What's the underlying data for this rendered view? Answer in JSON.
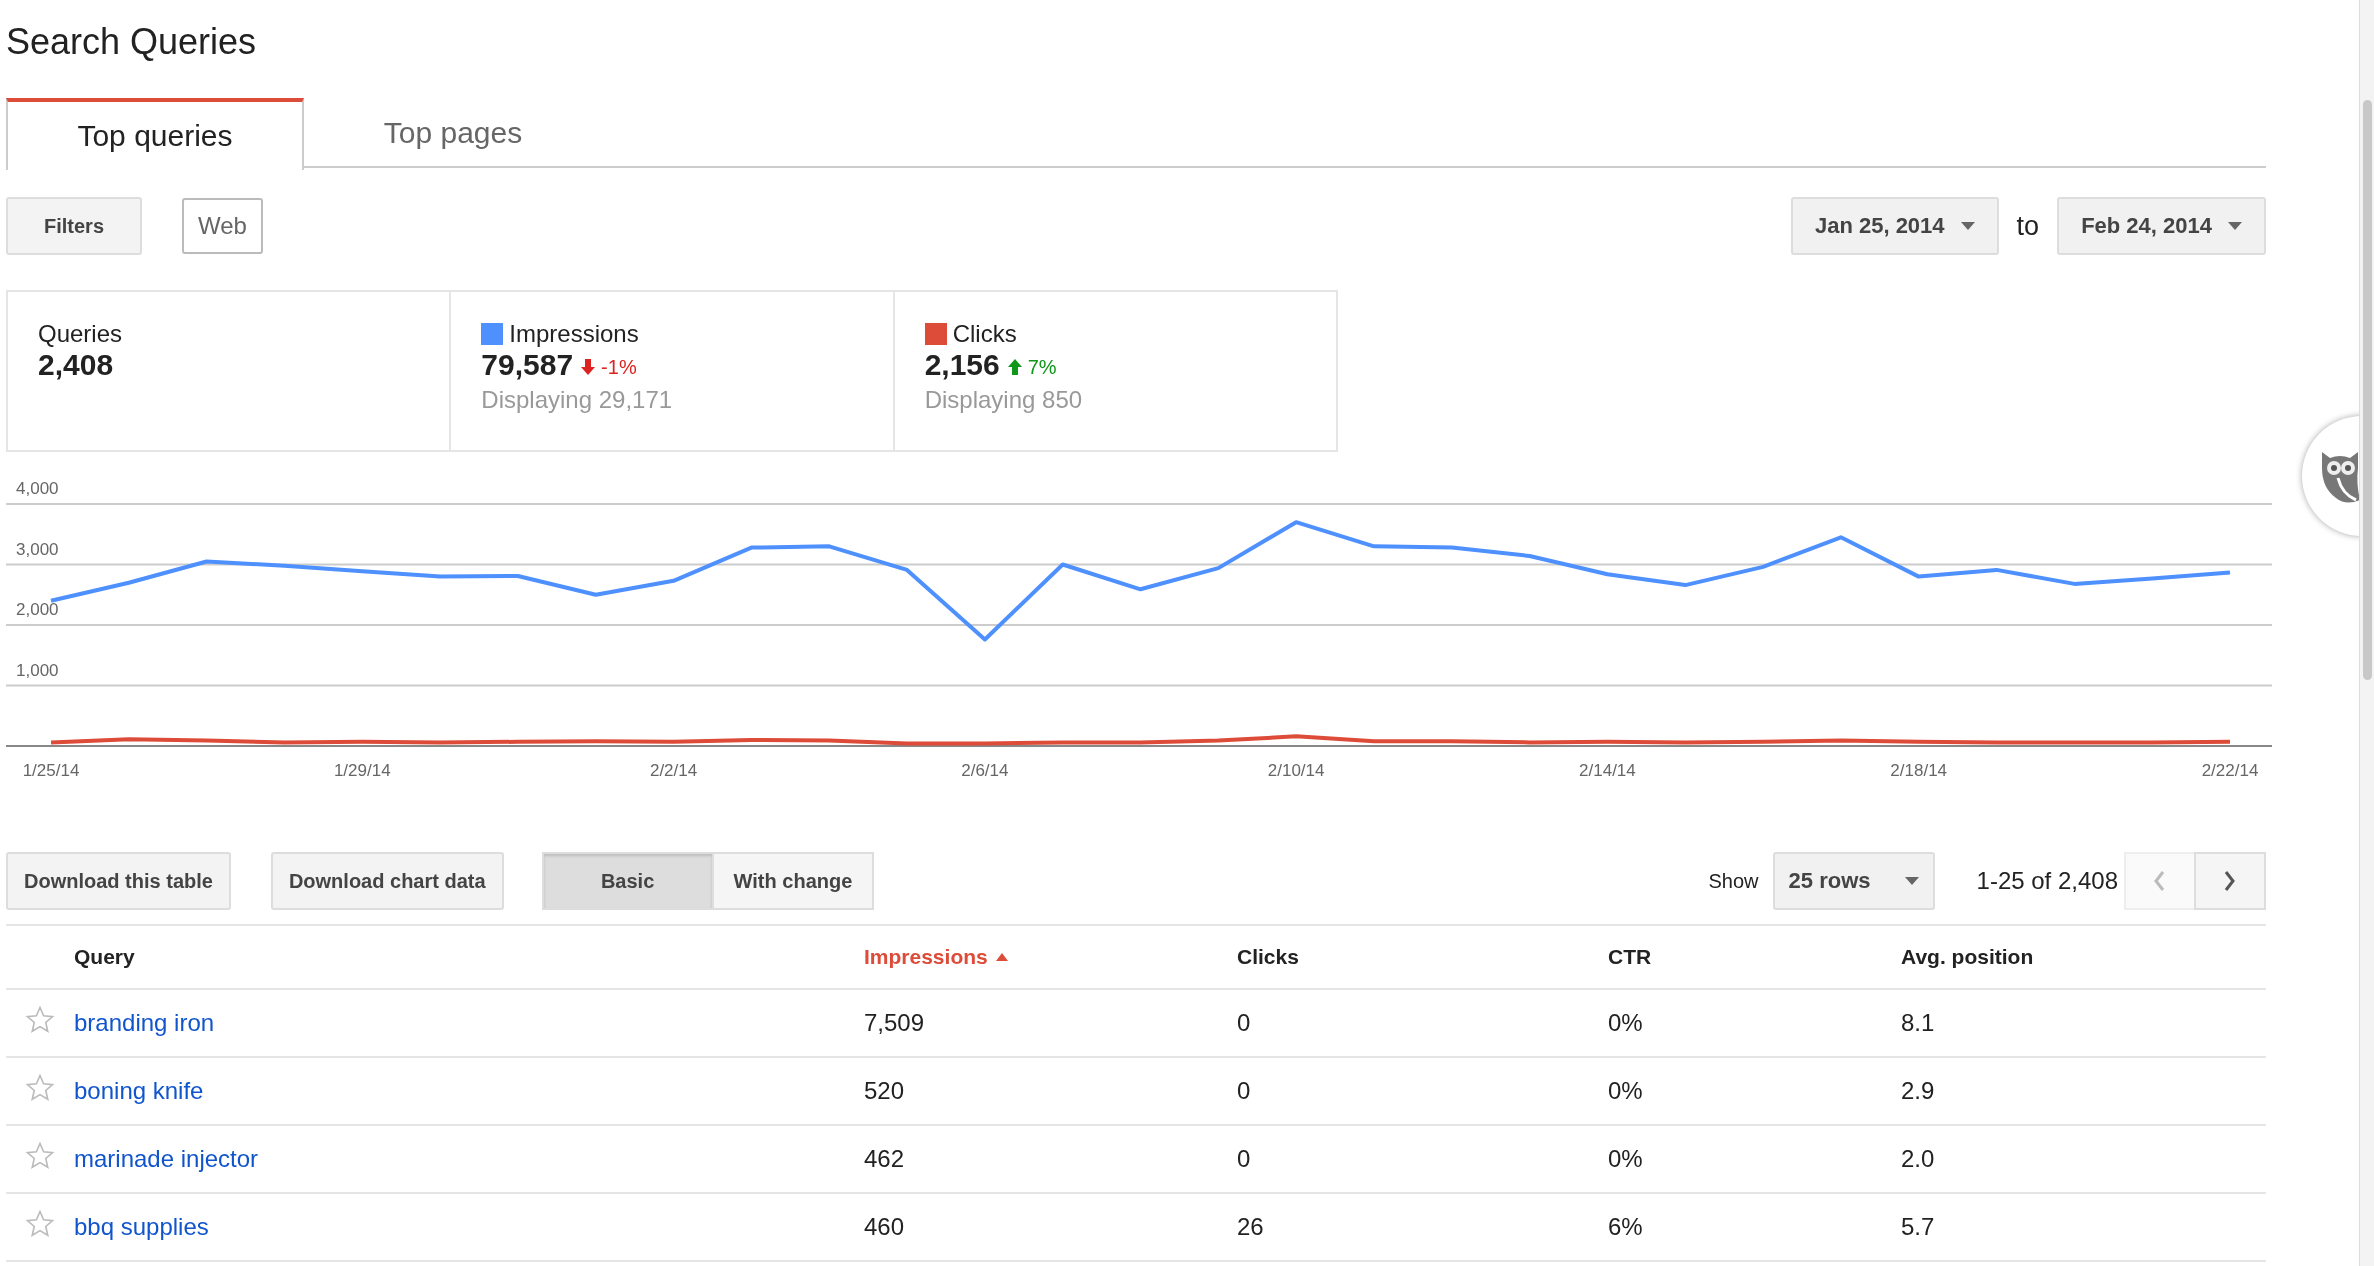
{
  "page": {
    "title": "Search Queries"
  },
  "tabs": [
    {
      "label": "Top queries",
      "selected": true
    },
    {
      "label": "Top pages",
      "selected": false
    }
  ],
  "filters": {
    "button": "Filters",
    "chip": "Web"
  },
  "date_range": {
    "start": "Jan 25, 2014",
    "separator": "to",
    "end": "Feb 24, 2014"
  },
  "stats": [
    {
      "label": "Queries",
      "value": "2,408"
    },
    {
      "value": "79,587",
      "change": "-1%",
      "kind": "down",
      "note": "Displaying 29,171"
    },
    {
      "value": "2,156",
      "change": "7%",
      "kind": "up",
      "note": "Displaying 850"
    }
  ],
  "chart": {
    "chart_data": {
      "type": "line",
      "categories": [
        "1/25/14",
        null,
        null,
        null,
        "1/29/14",
        null,
        null,
        null,
        "2/2/14",
        null,
        null,
        null,
        "2/6/14",
        null,
        null,
        null,
        "2/10/14",
        null,
        null,
        null,
        "2/14/14",
        null,
        null,
        null,
        "2/18/14",
        null,
        null,
        null,
        "2/22/14"
      ],
      "ylim": [
        0,
        4000
      ],
      "grid": true,
      "yticks": [
        {
          "value": 1000,
          "label": "1,000"
        },
        {
          "value": 2000,
          "label": "2,000"
        },
        {
          "value": 3000,
          "label": "3,000"
        },
        {
          "value": 4000,
          "label": "4,000"
        }
      ],
      "series": [
        {
          "name": "Impressions",
          "color": "#4d90fe",
          "values": [
            2400,
            2700,
            3050,
            2980,
            2890,
            2800,
            2810,
            2500,
            2730,
            3280,
            3300,
            2910,
            1760,
            3000,
            2590,
            2940,
            3700,
            3300,
            3280,
            3140,
            2840,
            2660,
            2960,
            3450,
            2800,
            2910,
            2680,
            2770,
            2870
          ]
        },
        {
          "name": "Clicks",
          "color": "#dd4b39",
          "values": [
            60,
            110,
            90,
            60,
            70,
            60,
            70,
            80,
            70,
            100,
            90,
            40,
            40,
            60,
            60,
            90,
            160,
            80,
            80,
            60,
            70,
            60,
            70,
            90,
            70,
            60,
            60,
            60,
            70
          ]
        }
      ]
    }
  },
  "table_toolbar": {
    "download_table": "Download this table",
    "download_chart": "Download chart data",
    "views": [
      {
        "label": "Basic",
        "selected": true
      },
      {
        "label": "With change",
        "selected": false
      }
    ],
    "show_label": "Show",
    "rows_select": "25 rows",
    "range": "1-25 of 2,408",
    "prev_disabled": true,
    "next_disabled": false
  },
  "table": {
    "columns": [
      {
        "label": "Query",
        "sorted": false
      },
      {
        "label": "Impressions",
        "sorted": true
      },
      {
        "label": "Clicks",
        "sorted": false
      },
      {
        "label": "CTR",
        "sorted": false
      },
      {
        "label": "Avg. position",
        "sorted": false
      }
    ],
    "rows": [
      {
        "starred": false,
        "cells": [
          "branding iron",
          "7,509",
          "0",
          "0%",
          "8.1"
        ]
      },
      {
        "starred": false,
        "cells": [
          "boning knife",
          "520",
          "0",
          "0%",
          "2.9"
        ]
      },
      {
        "starred": false,
        "cells": [
          "marinade injector",
          "462",
          "0",
          "0%",
          "2.0"
        ]
      },
      {
        "starred": false,
        "cells": [
          "bbq supplies",
          "460",
          "26",
          "6%",
          "5.7"
        ]
      }
    ]
  }
}
